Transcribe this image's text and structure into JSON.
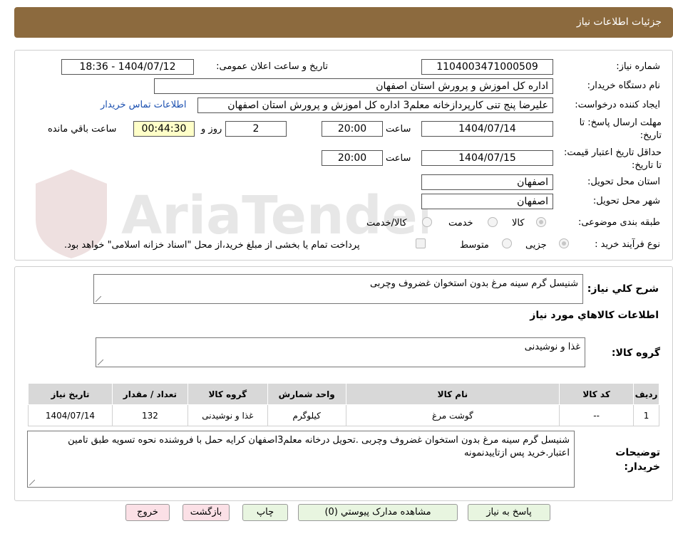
{
  "header": {
    "title": "جزئیات اطلاعات نیاز"
  },
  "form": {
    "need_number_label": "شماره نیاز:",
    "need_number": "1104003471000509",
    "announce_label": "تاریخ و ساعت اعلان عمومی:",
    "announce_value": "1404/07/12 - 18:36",
    "buyer_org_label": "نام دستگاه خریدار:",
    "buyer_org": "اداره کل اموزش و پرورش استان اصفهان",
    "requester_label": "ایجاد کننده درخواست:",
    "requester": "علیرضا پنج تنی کارپردازخانه معلم3 اداره کل اموزش و پرورش استان اصفهان",
    "contact_link": "اطلاعات تماس خریدار",
    "deadline_label": "مهلت ارسال پاسخ: تا تاریخ:",
    "deadline_date": "1404/07/14",
    "time_label": "ساعت",
    "deadline_time": "20:00",
    "days_value": "2",
    "days_label": "روز و",
    "remaining_time": "00:44:30",
    "remaining_label": "ساعت باقي مانده",
    "validity_label": "حداقل تاریخ اعتبار قیمت: تا تاریخ:",
    "validity_date": "1404/07/15",
    "validity_time": "20:00",
    "province_label": "استان محل تحویل:",
    "province": "اصفهان",
    "city_label": "شهر محل تحویل:",
    "city": "اصفهان",
    "category_label": "طبقه بندی موضوعی:",
    "category_options": [
      "کالا",
      "خدمت",
      "کالا/خدمت"
    ],
    "purchase_type_label": "نوع فرآیند خرید :",
    "purchase_options": [
      "جزیی",
      "متوسط"
    ],
    "payment_note": "پرداخت تمام یا بخشی از مبلغ خرید،از محل \"اسناد خزانه اسلامی\" خواهد بود."
  },
  "details": {
    "summary_label": "شرح کلي نياز:",
    "summary": "شنیسل گرم سینه مرغ بدون استخوان غضروف وچربی",
    "goods_title": "اطلاعات کالاهاي مورد نياز",
    "goods_group_label": "گروه کالا:",
    "goods_group": "غذا و نوشیدنی",
    "table": {
      "headers": [
        "رديف",
        "کد کالا",
        "نام کالا",
        "واحد شمارش",
        "گروه کالا",
        "تعداد / مقدار",
        "تاريخ نياز"
      ],
      "rows": [
        [
          "1",
          "--",
          "گوشت مرغ",
          "کیلوگرم",
          "غذا و نوشیدنی",
          "132",
          "1404/07/14"
        ]
      ]
    },
    "buyer_notes_label": "توضيحات خريدار:",
    "buyer_notes": "شنیسل گرم سینه مرغ بدون استخوان غضروف وچربی .تحویل درخانه معلم3اصفهان کرایه حمل با فروشنده نحوه تسویه طبق تامین اعتبار.خرید پس ازتاییدنمونه"
  },
  "buttons": {
    "reply": "پاسخ به نياز",
    "attachments": "مشاهده مدارک پيوستي (0)",
    "print": "چاپ",
    "back": "بازگشت",
    "exit": "خروج"
  },
  "watermark": {
    "text": "AriaTender.net"
  },
  "colors": {
    "header": "#8c6a3e",
    "button_green": "#e8f5e0",
    "button_pink": "#fbe0e6",
    "remaining_bg": "#ffffc8",
    "link": "#1a4fb0"
  }
}
